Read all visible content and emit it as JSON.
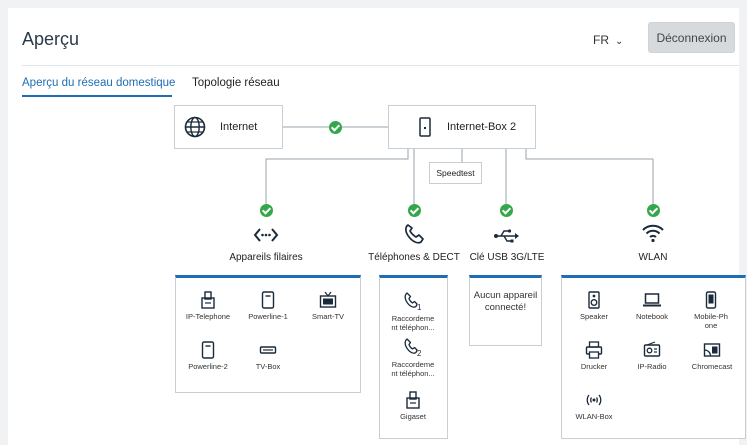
{
  "header": {
    "title": "Aperçu",
    "lang": "FR",
    "logout_label": "Déconnexion"
  },
  "tabs": [
    {
      "label": "Aperçu du réseau domestique",
      "active": true
    },
    {
      "label": "Topologie réseau",
      "active": false
    }
  ],
  "topology": {
    "internet_label": "Internet",
    "box_label": "Internet-Box 2",
    "speedtest_label": "Speedtest"
  },
  "categories": [
    {
      "label": "Appareils filaires",
      "icon": "ethernet-icon"
    },
    {
      "label": "Téléphones & DECT",
      "icon": "phone-icon"
    },
    {
      "label": "Clé USB 3G/LTE",
      "icon": "usb-icon"
    },
    {
      "label": "WLAN",
      "icon": "wifi-icon"
    }
  ],
  "wired_devices": [
    "IP-Telephone",
    "Powerline-1",
    "Smart-TV",
    "Powerline-2",
    "TV-Box"
  ],
  "phone_devices": [
    {
      "label1": "Raccordeme",
      "label2": "nt téléphon...",
      "num": "1"
    },
    {
      "label1": "Raccordeme",
      "label2": "nt téléphon...",
      "num": "2"
    },
    {
      "label1": "Gigaset",
      "label2": ""
    }
  ],
  "usb_status": "Aucun appareil connecté!",
  "wlan_devices": [
    "Speaker",
    "Notebook",
    "Mobile-Phone",
    "Drucker",
    "IP-Radio",
    "Chromecast",
    "WLAN-Box"
  ],
  "colors": {
    "accent": "#1e6db5",
    "ok": "#33a74a"
  }
}
